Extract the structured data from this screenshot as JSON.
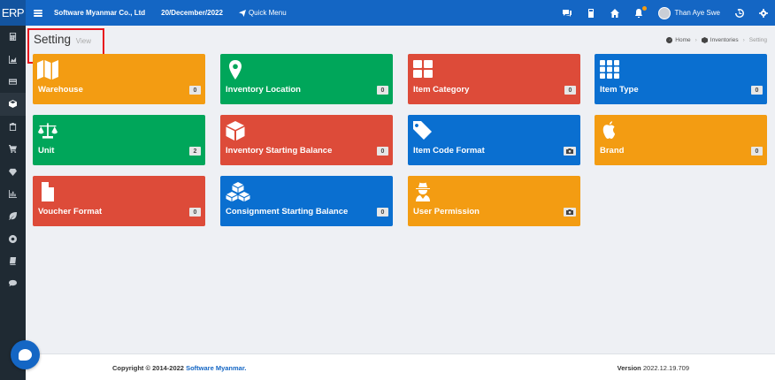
{
  "header": {
    "brand": "ERP",
    "company": "Software Myanmar Co., Ltd",
    "date": "20/December/2022",
    "quick_menu": "Quick Menu",
    "user_name": "Than Aye Swe"
  },
  "sidebar": {
    "items": [
      {
        "icon": "calculator-icon"
      },
      {
        "icon": "chart-area-icon"
      },
      {
        "icon": "credit-card-icon"
      },
      {
        "icon": "cube-icon",
        "active": true
      },
      {
        "icon": "clipboard-icon"
      },
      {
        "icon": "cart-icon"
      },
      {
        "icon": "diamond-icon"
      },
      {
        "icon": "bar-chart-icon"
      },
      {
        "icon": "leaf-icon"
      },
      {
        "icon": "life-ring-icon"
      },
      {
        "icon": "book-icon"
      },
      {
        "icon": "comment-icon"
      }
    ]
  },
  "page": {
    "title": "Setting",
    "subtitle": "View"
  },
  "breadcrumb": {
    "home": "Home",
    "section": "Inventories",
    "current": "Setting"
  },
  "tiles": [
    {
      "label": "Warehouse",
      "badge": "0",
      "color": "#f39c12",
      "icon": "map-icon"
    },
    {
      "label": "Inventory Location",
      "badge": "0",
      "color": "#00a65a",
      "icon": "map-marker-icon"
    },
    {
      "label": "Item Category",
      "badge": "0",
      "color": "#dd4b39",
      "icon": "grid-large-icon"
    },
    {
      "label": "Item Type",
      "badge": "0",
      "color": "#0a6fd0",
      "icon": "grid-small-icon"
    },
    {
      "label": "Unit",
      "badge": "2",
      "color": "#00a65a",
      "icon": "balance-scale-icon"
    },
    {
      "label": "Inventory Starting Balance",
      "badge": "0",
      "color": "#dd4b39",
      "icon": "cube-icon"
    },
    {
      "label": "Item Code Format",
      "badge": "",
      "badge_icon": "camera-icon",
      "color": "#0a6fd0",
      "icon": "tag-icon"
    },
    {
      "label": "Brand",
      "badge": "0",
      "color": "#f39c12",
      "icon": "apple-icon"
    },
    {
      "label": "Voucher Format",
      "badge": "0",
      "color": "#dd4b39",
      "icon": "file-icon"
    },
    {
      "label": "Consignment Starting Balance",
      "badge": "0",
      "color": "#0a6fd0",
      "icon": "cubes-icon"
    },
    {
      "label": "User Permission",
      "badge": "",
      "badge_icon": "camera-icon",
      "color": "#f39c12",
      "icon": "user-secret-icon"
    }
  ],
  "footer": {
    "copyright": "Copyright © 2014-2022 ",
    "company_link": "Software Myanmar.",
    "version_label": "Version",
    "version_value": " 2022.12.19.709"
  }
}
